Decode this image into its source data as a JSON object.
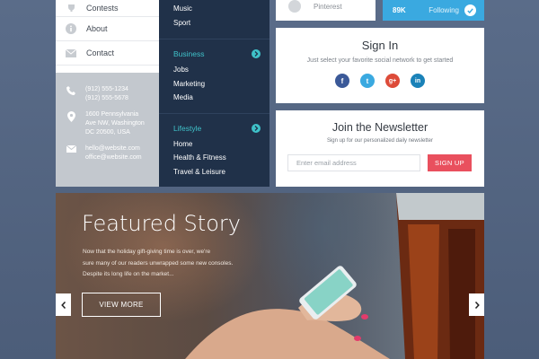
{
  "nav": {
    "items": [
      {
        "label": "Contests",
        "icon": "trophy-icon"
      },
      {
        "label": "About",
        "icon": "info-icon"
      },
      {
        "label": "Contact",
        "icon": "envelope-icon"
      }
    ]
  },
  "contact": {
    "phone_1": "(912) 555-1234",
    "phone_2": "(912) 555-5678",
    "address_1": "1600 Pennsylvania",
    "address_2": "Ave NW, Washington",
    "address_3": "DC 20500, USA",
    "email_1": "hello@website.com",
    "email_2": "office@website.com"
  },
  "categories": {
    "top_items": [
      "Music",
      "Sport"
    ],
    "groups": [
      {
        "title": "Business",
        "items": [
          "Jobs",
          "Marketing",
          "Media"
        ]
      },
      {
        "title": "Lifestyle",
        "items": [
          "Home",
          "Health & Fitness",
          "Travel & Leisure"
        ]
      }
    ]
  },
  "social_strip": {
    "pinterest_label": "Pinterest",
    "follower_count": "89K",
    "following_label": "Following"
  },
  "signin": {
    "title": "Sign In",
    "subtitle": "Just select your favorite social network to get started",
    "networks": [
      {
        "letter": "f",
        "color": "#3b5998"
      },
      {
        "letter": "t",
        "color": "#3aa9e0"
      },
      {
        "letter": "g+",
        "color": "#dd4b39"
      },
      {
        "letter": "in",
        "color": "#1a82b8"
      }
    ]
  },
  "newsletter": {
    "title": "Join the Newsletter",
    "subtitle": "Sign up for our personalized daily newsletter",
    "placeholder": "Enter email address",
    "button": "SIGN UP"
  },
  "featured": {
    "title": "Featured Story",
    "text_1": "Now that the holiday gift-giving time is over, we're",
    "text_2": "sure many of our readers unwrapped some new consoles.",
    "text_3": "Despite its long life on the market...",
    "button": "VIEW MORE"
  },
  "colors": {
    "accent_teal": "#3fc2c9",
    "twitter_blue": "#3aa9e0",
    "signup_red": "#e9505e",
    "dark_navy": "#203149"
  }
}
